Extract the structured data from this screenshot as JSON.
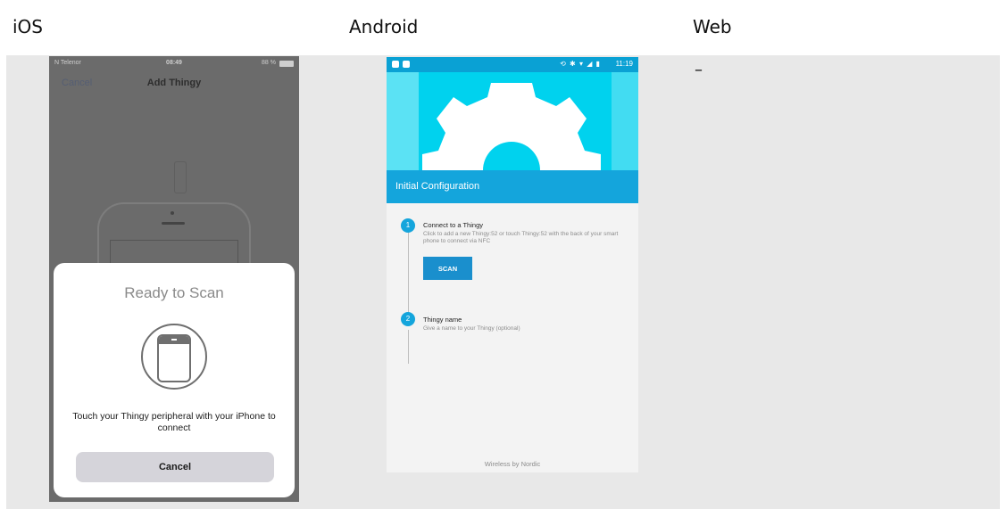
{
  "columns": [
    {
      "heading": "iOS"
    },
    {
      "heading": "Android"
    },
    {
      "heading": "Web"
    }
  ],
  "ios": {
    "status": {
      "carrier": "N Telenor",
      "time": "08:49",
      "battery": "88 %"
    },
    "nav": {
      "cancel": "Cancel",
      "title": "Add Thingy"
    },
    "sheet": {
      "title": "Ready to Scan",
      "message": "Touch your Thingy peripheral with your iPhone to connect",
      "cancel_label": "Cancel",
      "icon": "phone-in-circle-icon"
    }
  },
  "android": {
    "status": {
      "time": "11:19",
      "system_icons": "⟲ ✱ ▾ ◢ ▮"
    },
    "toolbar_title": "Initial Configuration",
    "banner_icon": "gear-icon",
    "steps": [
      {
        "number": "1",
        "title": "Connect to a Thingy",
        "description": "Click to add a new Thingy:52 or touch Thingy:52 with the back of your smart phone to connect via NFC"
      },
      {
        "number": "2",
        "title": "Thingy name",
        "description": "Give a name to your Thingy (optional)"
      }
    ],
    "scan_label": "SCAN",
    "footer": "Wireless by Nordic"
  },
  "web": {
    "placeholder": "–"
  },
  "colors": {
    "content_bg": "#e8e8e8",
    "android_accent": "#14a5dc",
    "android_banner": "#00d2ee",
    "ios_dim": "#6b6b6b"
  }
}
